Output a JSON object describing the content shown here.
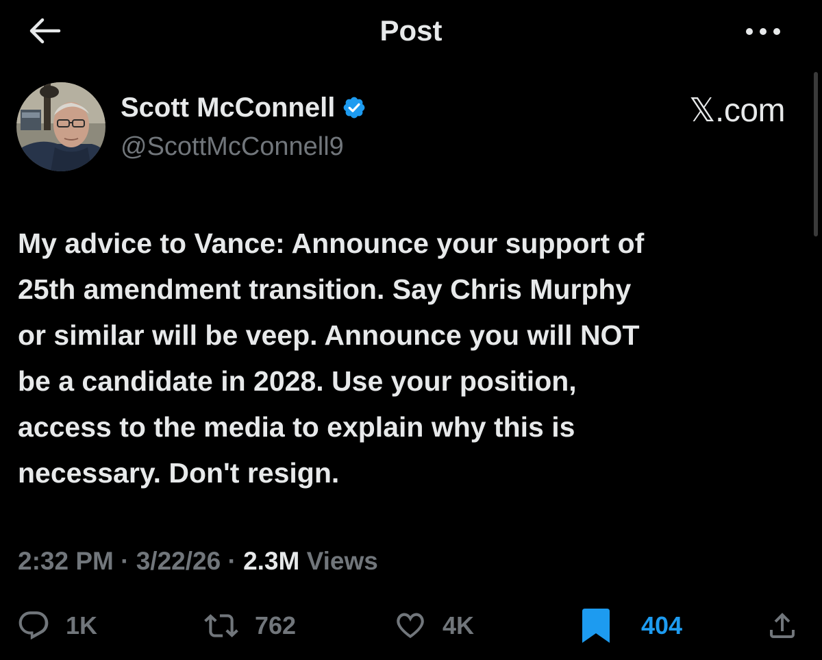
{
  "header": {
    "title": "Post",
    "back_icon": "arrow-left-icon",
    "more_icon": "more-horizontal-icon"
  },
  "author": {
    "name": "Scott McConnell",
    "handle": "@ScottMcConnell9",
    "verified_icon": "verified-badge-icon",
    "verified_color": "#1d9bf0"
  },
  "source_label": "𝕏.com",
  "post": {
    "text": "My advice to Vance: Announce your support of\n25th amendment transition. Say Chris Murphy\nor similar will be veep. Announce  you will NOT\nbe a candidate in 2028. Use your position,\naccess to the media to explain why this is\nnecessary. Don't resign."
  },
  "meta": {
    "time": "2:32 PM",
    "sep1": " · ",
    "date": "3/22/26",
    "sep2": " · ",
    "views_count": "2.3M",
    "views_label": " Views"
  },
  "actions": {
    "replies": {
      "icon": "reply-icon",
      "count": "1K"
    },
    "reposts": {
      "icon": "repost-icon",
      "count": "762"
    },
    "likes": {
      "icon": "heart-icon",
      "count": "4K"
    },
    "bookmarks": {
      "icon": "bookmark-icon",
      "count": "404",
      "active": true,
      "color": "#1d9bf0"
    },
    "share": {
      "icon": "share-icon"
    }
  },
  "colors": {
    "background": "#000000",
    "text_primary": "#e7e9ea",
    "text_secondary": "#71767b",
    "accent": "#1d9bf0"
  }
}
